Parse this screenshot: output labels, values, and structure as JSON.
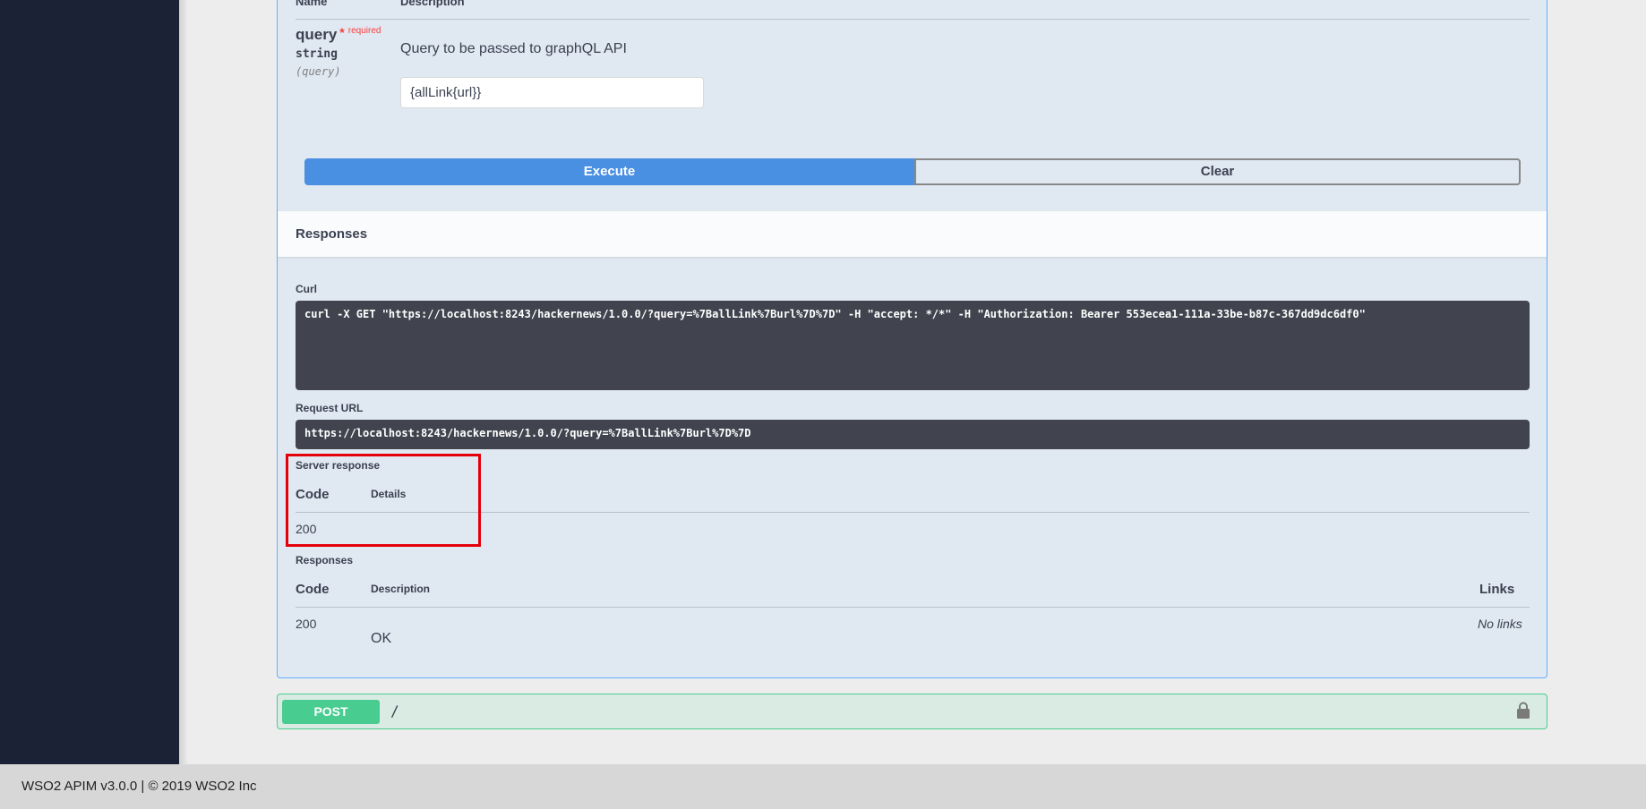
{
  "parameters": {
    "header_name": "Name",
    "header_description": "Description",
    "param": {
      "name": "query",
      "required_star": "*",
      "required_label": "required",
      "type": "string",
      "location": "(query)",
      "description": "Query to be passed to graphQL API",
      "value": "{allLink{url}}"
    }
  },
  "actions": {
    "execute": "Execute",
    "clear": "Clear"
  },
  "responses_section": {
    "title": "Responses",
    "curl_label": "Curl",
    "curl": "curl -X GET \"https://localhost:8243/hackernews/1.0.0/?query=%7BallLink%7Burl%7D%7D\" -H \"accept: */*\" -H \"Authorization: Bearer 553ecea1-111a-33be-b87c-367dd9dc6df0\"",
    "request_url_label": "Request URL",
    "request_url": "https://localhost:8243/hackernews/1.0.0/?query=%7BallLink%7Burl%7D%7D",
    "server_response": {
      "label": "Server response",
      "code_header": "Code",
      "details_header": "Details",
      "code": "200"
    },
    "responses": {
      "label": "Responses",
      "code_header": "Code",
      "description_header": "Description",
      "links_header": "Links",
      "rows": [
        {
          "code": "200",
          "description": "OK",
          "links": "No links"
        }
      ]
    }
  },
  "post_operation": {
    "method": "POST",
    "path": "/",
    "icon": "lock-icon"
  },
  "footer": {
    "text": "WSO2 APIM v3.0.0 | © 2019 WSO2 Inc"
  },
  "colors": {
    "sidebar": "#1b2236",
    "get_border": "#61affe",
    "execute": "#4990e2",
    "post": "#49cc90",
    "highlight": "#e3000b"
  }
}
